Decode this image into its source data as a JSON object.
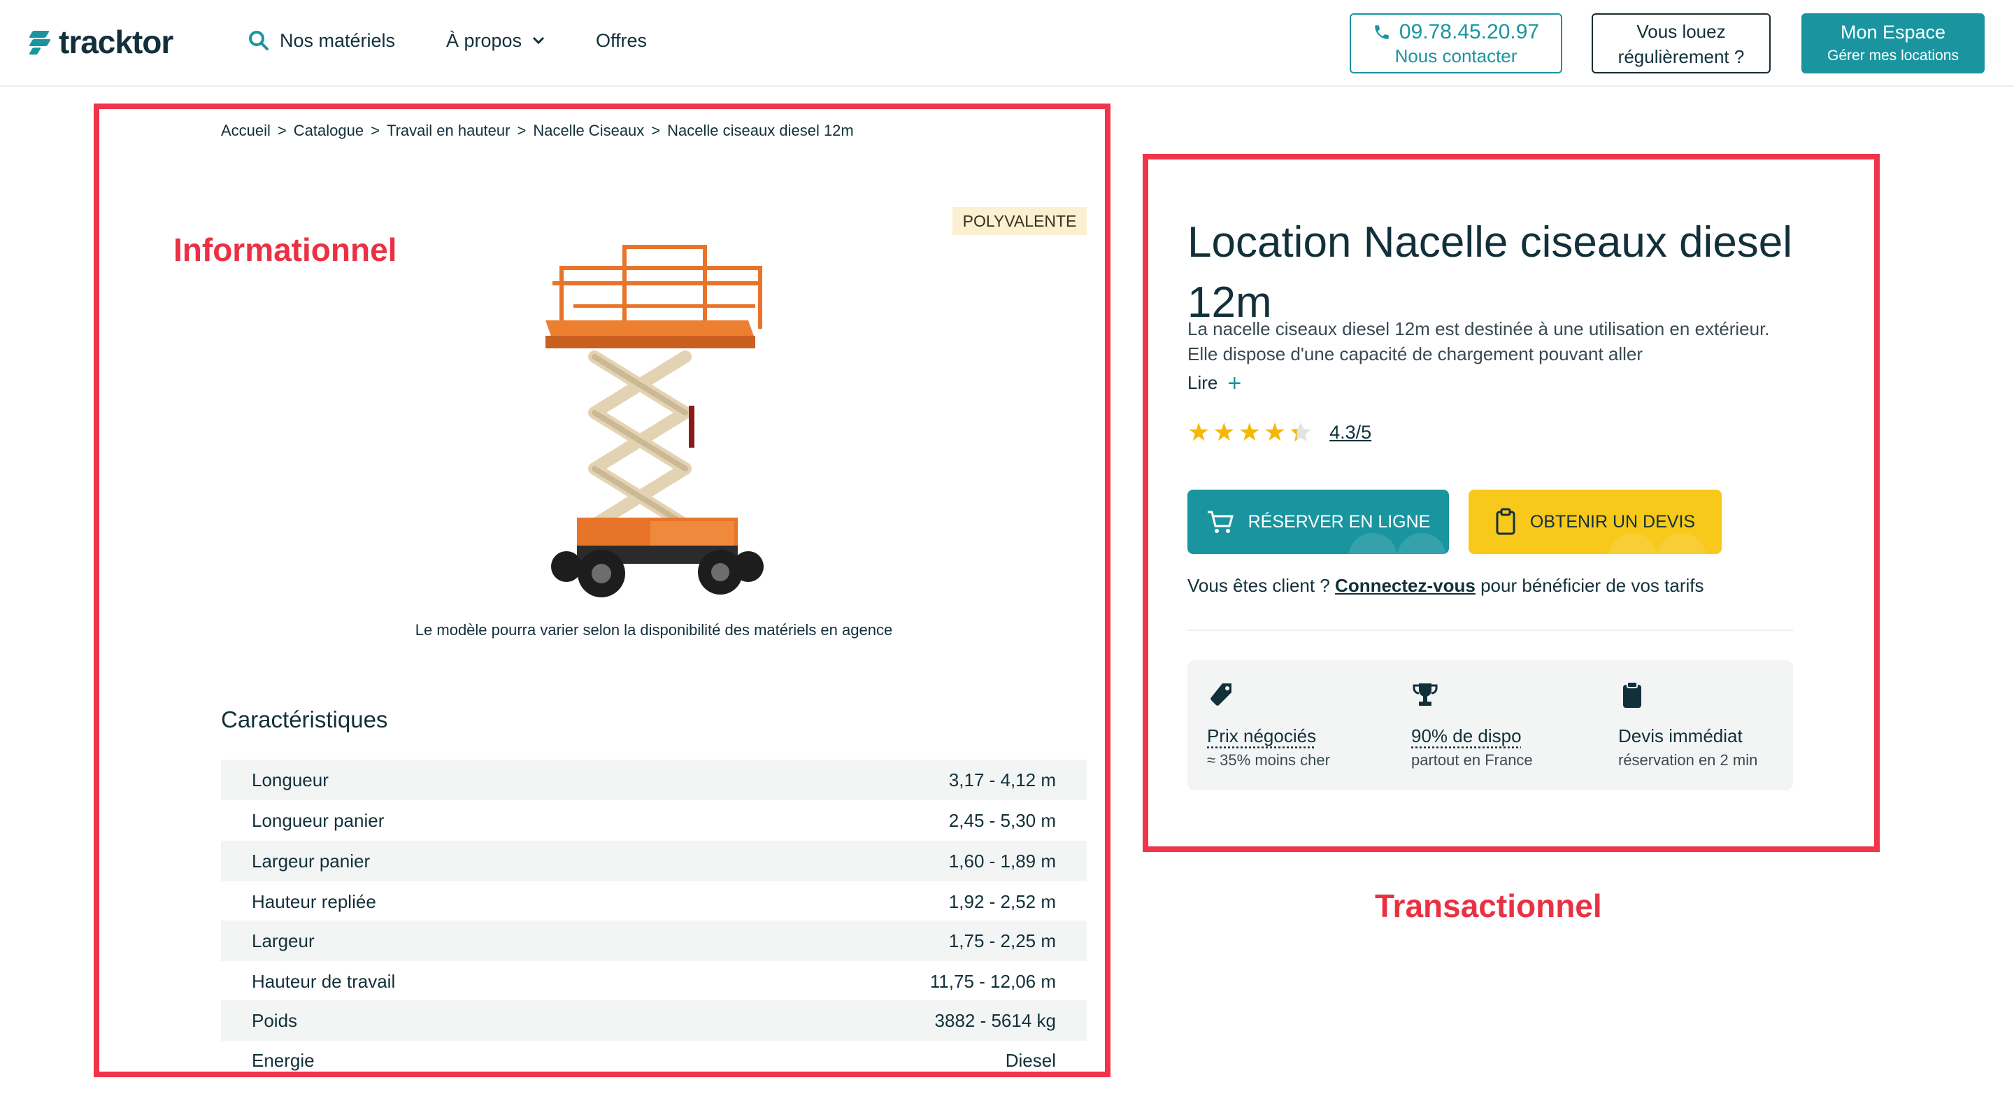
{
  "header": {
    "logo_text": "tracktor",
    "nav": [
      {
        "label": "Nos matériels"
      },
      {
        "label": "À propos"
      },
      {
        "label": "Offres"
      }
    ],
    "phone": "09.78.45.20.97",
    "contact_label": "Nous contacter",
    "regular_line1": "Vous louez",
    "regular_line2": "régulièrement ?",
    "espace_line1": "Mon Espace",
    "espace_line2": "Gérer mes locations"
  },
  "annotations": {
    "left_label": "Informationnel",
    "right_label": "Transactionnel"
  },
  "breadcrumb": [
    "Accueil",
    "Catalogue",
    "Travail en hauteur",
    "Nacelle Ciseaux",
    "Nacelle ciseaux diesel 12m"
  ],
  "product": {
    "badge": "POLYVALENTE",
    "caption": "Le modèle pourra varier selon la disponibilité des matériels en agence",
    "title": "Location Nacelle ciseaux diesel 12m",
    "description": "La nacelle ciseaux diesel 12m est destinée à une utilisation en extérieur. Elle dispose d'une capacité de chargement pouvant aller",
    "read_more": "Lire",
    "rating_value": 4.3,
    "rating_text": "4.3/5",
    "reserve_label": "RÉSERVER EN LIGNE",
    "devis_label": "OBTENIR UN DEVIS",
    "client_prefix": "Vous êtes client ?",
    "client_link": "Connectez-vous",
    "client_suffix": "pour bénéficier de vos tarifs"
  },
  "specs": {
    "title": "Caractéristiques",
    "rows": [
      {
        "label": "Longueur",
        "value": "3,17 - 4,12 m"
      },
      {
        "label": "Longueur panier",
        "value": "2,45 - 5,30 m"
      },
      {
        "label": "Largeur panier",
        "value": "1,60 - 1,89 m"
      },
      {
        "label": "Hauteur repliée",
        "value": "1,92 - 2,52 m"
      },
      {
        "label": "Largeur",
        "value": "1,75 - 2,25 m"
      },
      {
        "label": "Hauteur de travail",
        "value": "11,75 - 12,06 m"
      },
      {
        "label": "Poids",
        "value": "3882 - 5614 kg"
      },
      {
        "label": "Energie",
        "value": "Diesel"
      }
    ]
  },
  "perks": [
    {
      "icon": "price-tag-icon",
      "title": "Prix négociés",
      "sub": "≈ 35% moins cher"
    },
    {
      "icon": "trophy-icon",
      "title": "90% de dispo",
      "sub": "partout en France"
    },
    {
      "icon": "clipboard-icon",
      "title": "Devis immédiat",
      "sub": "réservation en 2 min"
    }
  ],
  "colors": {
    "brand_teal": "#1a95a0",
    "cta_yellow": "#f8c81a",
    "annotation_red": "#f0344a",
    "text_dark": "#12303a"
  }
}
